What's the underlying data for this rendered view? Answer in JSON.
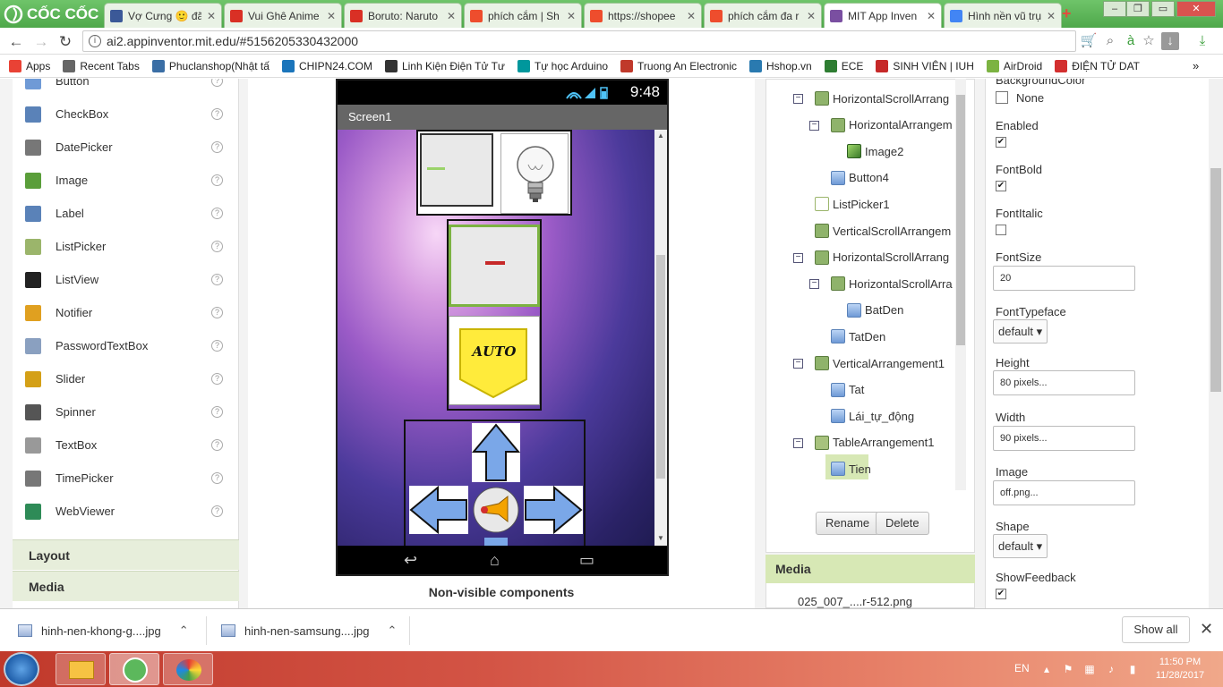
{
  "browser": {
    "brand": "CỐC CỐC",
    "tabs": [
      {
        "label": "Vợ Cưng 🙂 đã",
        "color": "#3b5998"
      },
      {
        "label": "Vui Ghê Anime",
        "color": "#d93025"
      },
      {
        "label": "Boruto: Naruto",
        "color": "#d93025"
      },
      {
        "label": "phích cắm | Sh",
        "color": "#ee4d2d"
      },
      {
        "label": "https://shopee",
        "color": "#ee4d2d"
      },
      {
        "label": "phích cắm đa r",
        "color": "#ee4d2d"
      },
      {
        "label": "MIT App Inven",
        "color": "#7a4fa1"
      },
      {
        "label": "Hình nền vũ trụ",
        "color": "#4285f4"
      }
    ],
    "active_tab": 6,
    "url": "ai2.appinventor.mit.edu/#5156205330432000",
    "bookmarks": [
      {
        "label": "Apps",
        "color": "#e94235"
      },
      {
        "label": "Recent Tabs",
        "color": "#666666"
      },
      {
        "label": "Phuclanshop(Nhật tấ",
        "color": "#3a6ea5"
      },
      {
        "label": "CHIPN24.COM",
        "color": "#1b75bb"
      },
      {
        "label": "Linh Kiện Điện Tử Tư",
        "color": "#333333"
      },
      {
        "label": "Tự học Arduino",
        "color": "#00979c"
      },
      {
        "label": "Truong An Electronic",
        "color": "#c0392b"
      },
      {
        "label": "Hshop.vn",
        "color": "#2a7ab0"
      },
      {
        "label": "ECE",
        "color": "#2e7d32"
      },
      {
        "label": "SINH VIÊN | IUH",
        "color": "#c62828"
      },
      {
        "label": "AirDroid",
        "color": "#7cb342"
      },
      {
        "label": "ĐIỆN TỬ DAT",
        "color": "#d32f2f"
      }
    ]
  },
  "palette": {
    "items": [
      {
        "label": "Button",
        "icon": "button-icon",
        "color": "#6f9ad6"
      },
      {
        "label": "CheckBox",
        "icon": "checkbox-icon",
        "color": "#5a82b8"
      },
      {
        "label": "DatePicker",
        "icon": "datepicker-icon",
        "color": "#777777"
      },
      {
        "label": "Image",
        "icon": "image-icon",
        "color": "#5a9e3a"
      },
      {
        "label": "Label",
        "icon": "label-icon",
        "color": "#5a82b8"
      },
      {
        "label": "ListPicker",
        "icon": "listpicker-icon",
        "color": "#9bb56b"
      },
      {
        "label": "ListView",
        "icon": "listview-icon",
        "color": "#222222"
      },
      {
        "label": "Notifier",
        "icon": "notifier-icon",
        "color": "#e0a020"
      },
      {
        "label": "PasswordTextBox",
        "icon": "password-icon",
        "color": "#8aa0c0"
      },
      {
        "label": "Slider",
        "icon": "slider-icon",
        "color": "#d4a017"
      },
      {
        "label": "Spinner",
        "icon": "spinner-icon",
        "color": "#555555"
      },
      {
        "label": "TextBox",
        "icon": "textbox-icon",
        "color": "#999999"
      },
      {
        "label": "TimePicker",
        "icon": "timepicker-icon",
        "color": "#777777"
      },
      {
        "label": "WebViewer",
        "icon": "webviewer-icon",
        "color": "#2e8b57"
      }
    ],
    "categories": [
      "Layout",
      "Media"
    ]
  },
  "viewer": {
    "clock": "9:48",
    "screen_title": "Screen1",
    "auto_label": "AUTO",
    "non_visible": "Non-visible components"
  },
  "components": {
    "nodes": [
      {
        "label": "HorizontalScrollArrang",
        "icon": "harr",
        "toggle": "−"
      },
      {
        "label": "HorizontalArrangem",
        "icon": "harr",
        "toggle": "−"
      },
      {
        "label": "Image2",
        "icon": "img",
        "toggle": ""
      },
      {
        "label": "Button4",
        "icon": "btn",
        "toggle": ""
      },
      {
        "label": "ListPicker1",
        "icon": "lp",
        "toggle": ""
      },
      {
        "label": "VerticalScrollArrangem",
        "icon": "varr",
        "toggle": ""
      },
      {
        "label": "HorizontalScrollArrang",
        "icon": "harr",
        "toggle": "−"
      },
      {
        "label": "HorizontalScrollArra",
        "icon": "harr",
        "toggle": "−"
      },
      {
        "label": "BatDen",
        "icon": "btn",
        "toggle": ""
      },
      {
        "label": "TatDen",
        "icon": "btn",
        "toggle": ""
      },
      {
        "label": "VerticalArrangement1",
        "icon": "varr",
        "toggle": "−"
      },
      {
        "label": "Tat",
        "icon": "btn",
        "toggle": ""
      },
      {
        "label": "Lái_tự_động",
        "icon": "btn",
        "toggle": ""
      },
      {
        "label": "TableArrangement1",
        "icon": "tbl",
        "toggle": "−"
      },
      {
        "label": "Tien",
        "icon": "btn",
        "toggle": ""
      }
    ],
    "rename": "Rename",
    "delete": "Delete"
  },
  "media": {
    "header": "Media",
    "file": "025_007_....r-512.png"
  },
  "properties": {
    "background_color_label": "BackgroundColor",
    "background_color_value": "None",
    "enabled_label": "Enabled",
    "enabled": true,
    "fontbold_label": "FontBold",
    "fontbold": true,
    "fontitalic_label": "FontItalic",
    "fontitalic": false,
    "fontsize_label": "FontSize",
    "fontsize_value": "20",
    "fonttypeface_label": "FontTypeface",
    "fonttypeface_value": "default",
    "height_label": "Height",
    "height_value": "80 pixels...",
    "width_label": "Width",
    "width_value": "90 pixels...",
    "image_label": "Image",
    "image_value": "off.png...",
    "shape_label": "Shape",
    "shape_value": "default",
    "showfeedback_label": "ShowFeedback",
    "showfeedback": true
  },
  "downloads": {
    "items": [
      "hinh-nen-khong-g....jpg",
      "hinh-nen-samsung....jpg"
    ],
    "show_all": "Show all"
  },
  "taskbar": {
    "lang": "EN",
    "time": "11:50 PM",
    "date": "11/28/2017"
  }
}
